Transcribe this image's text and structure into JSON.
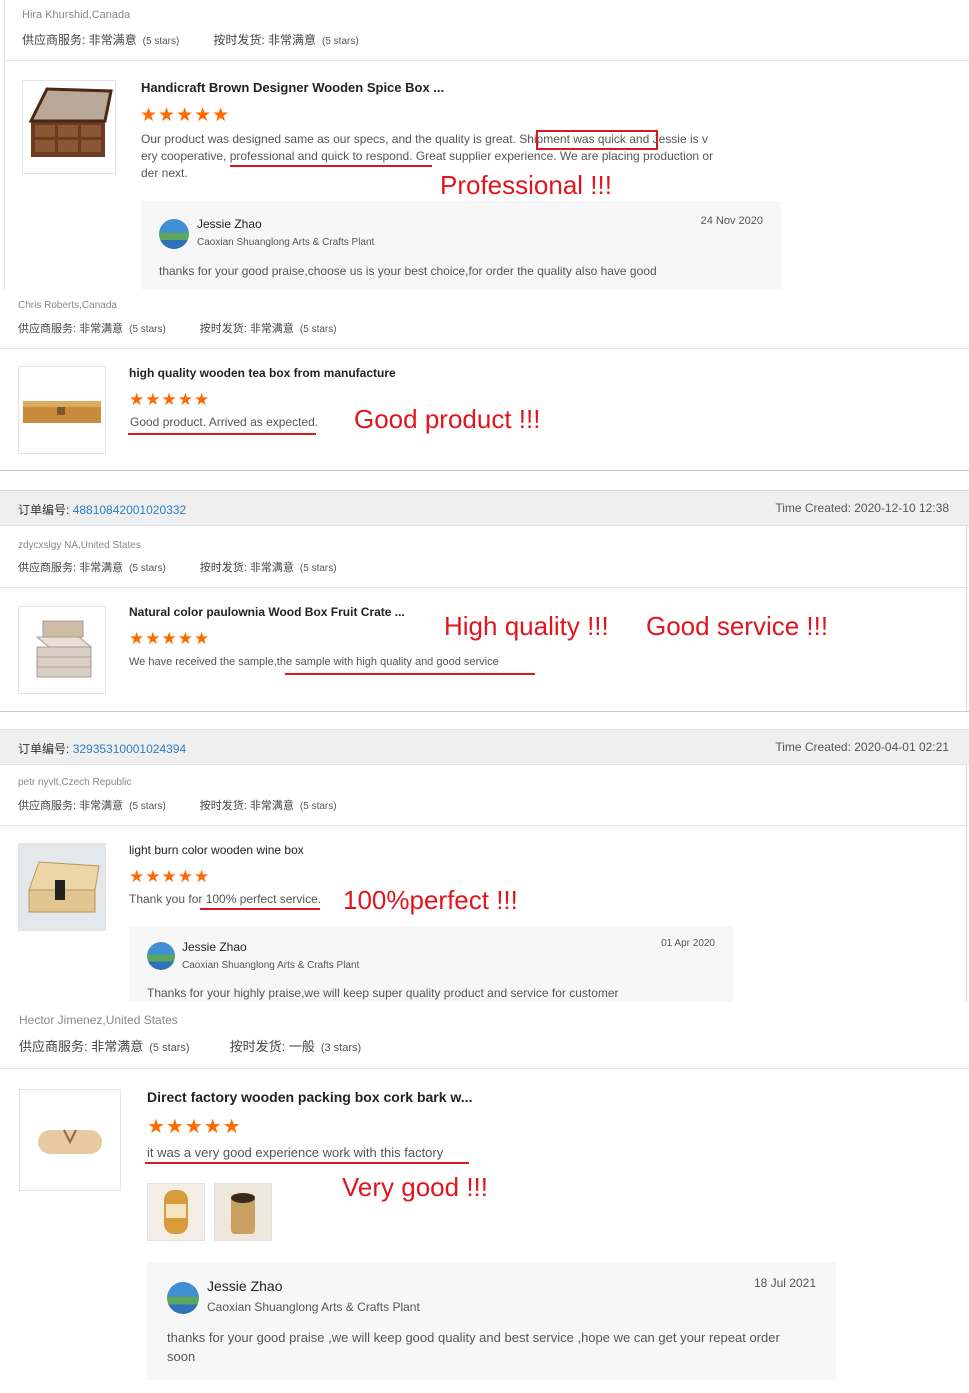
{
  "reviews": [
    {
      "buyer": "Hira Khurshid,Canada",
      "service_label": "供应商服务: 非常满意",
      "service_stars": "(5 stars)",
      "shipping_label": "按时发货: 非常满意",
      "shipping_stars": "(5 stars)",
      "product_title": "Handicraft Brown Designer Wooden Spice Box ...",
      "rating": 5,
      "stars_text": "★★★★★",
      "review_lines": [
        "Our product was designed same as our specs, and the quality is great. Shipment was quick and Jessie is v",
        "ery cooperative, professional and quick to respond. Great supplier experience. We are placing production or",
        "der next."
      ],
      "annotation": "Professional !!!",
      "reply": {
        "name": "Jessie Zhao",
        "company": "Caoxian Shuanglong Arts & Crafts Plant",
        "date": "24 Nov 2020",
        "text": "thanks for  your good praise,choose us is your best choice,for order the  quality also have good"
      }
    },
    {
      "buyer": "Chris Roberts,Canada",
      "service_label": "供应商服务: 非常满意",
      "service_stars": "(5 stars)",
      "shipping_label": "按时发货: 非常满意",
      "shipping_stars": "(5 stars)",
      "product_title": "high quality wooden tea box from manufacture",
      "rating": 5,
      "stars_text": "★★★★★",
      "review_text": "Good product. Arrived as expected.",
      "annotation": "Good product !!!"
    },
    {
      "order_label": "订单编号:",
      "order_no": "48810842001020332",
      "time_created": "Time Created: 2020-12-10 12:38",
      "buyer": "zdycxslgy NA,United States",
      "service_label": "供应商服务: 非常满意",
      "service_stars": "(5 stars)",
      "shipping_label": "按时发货: 非常满意",
      "shipping_stars": "(5 stars)",
      "product_title": "Natural color paulownia Wood Box Fruit Crate ...",
      "rating": 5,
      "stars_text": "★★★★★",
      "review_text": "We have received the sample,the sample with high quality and good service",
      "annotation": "High quality !!!",
      "annotation2": "Good service !!!"
    },
    {
      "order_label": "订单编号:",
      "order_no": "32935310001024394",
      "time_created": "Time Created: 2020-04-01 02:21",
      "buyer": "petr nyvlt,Czech Republic",
      "service_label": "供应商服务: 非常满意",
      "service_stars": "(5 stars)",
      "shipping_label": "按时发货: 非常满意",
      "shipping_stars": "(5 stars)",
      "product_title": "light burn color wooden wine box",
      "rating": 5,
      "stars_text": "★★★★★",
      "review_text": "Thank you for 100% perfect service.",
      "annotation": "100%perfect   !!!",
      "reply": {
        "name": "Jessie Zhao",
        "company": "Caoxian Shuanglong Arts & Crafts Plant",
        "date": "01 Apr 2020",
        "text": "Thanks for your highly praise,we will keep super quality product and service for customer"
      }
    },
    {
      "buyer": "Hector Jimenez,United States",
      "service_label": "供应商服务: 非常满意",
      "service_stars": "(5 stars)",
      "shipping_label": "按时发货: 一般",
      "shipping_stars": "(3 stars)",
      "product_title": "Direct factory wooden packing box cork bark w...",
      "rating": 5,
      "stars_text": "★★★★★",
      "review_text": "it was a very good experience work with this factory",
      "annotation": "Very good !!!",
      "reply": {
        "name": "Jessie Zhao",
        "company": "Caoxian Shuanglong Arts & Crafts Plant",
        "date": "18 Jul 2021",
        "text_line1": "thanks for your good praise ,we will keep good quality and best service ,hope we can get your repeat order",
        "text_line2": "soon"
      }
    }
  ]
}
